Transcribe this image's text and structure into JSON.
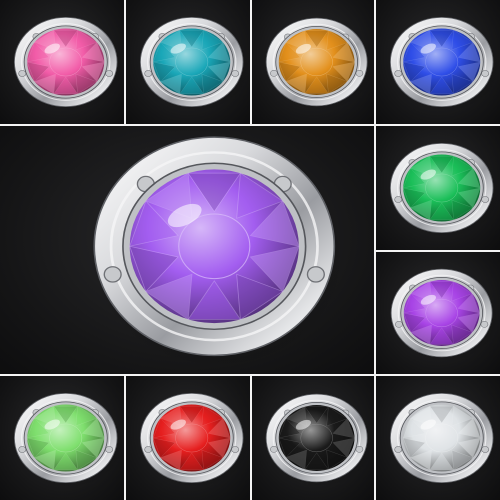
{
  "background_color": "#151516",
  "gap_color": "#f4f4f4",
  "tiles": [
    {
      "id": "pink",
      "color": "#f25ca8",
      "featured": false
    },
    {
      "id": "teal",
      "color": "#1aa7b8",
      "featured": false
    },
    {
      "id": "amber",
      "color": "#e3901c",
      "featured": false
    },
    {
      "id": "blue",
      "color": "#2f4ee8",
      "featured": false
    },
    {
      "id": "violet-large",
      "color": "#a35ef0",
      "featured": true
    },
    {
      "id": "green",
      "color": "#1bbf59",
      "featured": false
    },
    {
      "id": "violet",
      "color": "#a844e6",
      "featured": false
    },
    {
      "id": "light-green",
      "color": "#7fdf6e",
      "featured": false
    },
    {
      "id": "red",
      "color": "#e61f1f",
      "featured": false
    },
    {
      "id": "black",
      "color": "#1a1a1a",
      "featured": false
    },
    {
      "id": "clear",
      "color": "#dfe3e6",
      "featured": false
    }
  ]
}
